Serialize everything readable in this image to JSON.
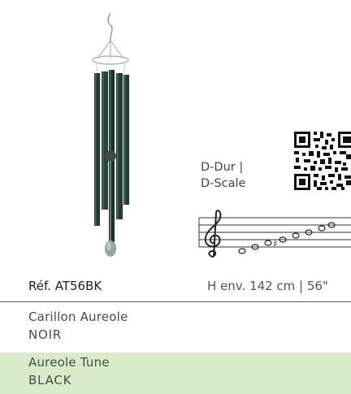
{
  "scale": {
    "line1": "D-Dur |",
    "line2": "D-Scale"
  },
  "product": {
    "reference": "Réf. AT56BK",
    "dimensions": "H env. 142 cm | 56\""
  },
  "name_fr": {
    "title": "Carillon Aureole",
    "color": "NOIR"
  },
  "name_en": {
    "title": "Aureole Tune",
    "color": "BLACK"
  },
  "colors": {
    "highlight_band": "#d9ecc9",
    "chime_tube": "#1f3a30"
  }
}
